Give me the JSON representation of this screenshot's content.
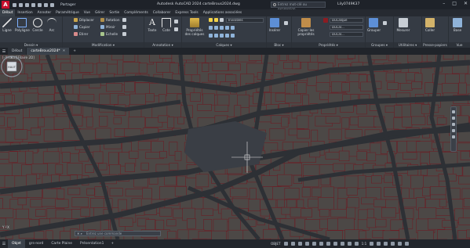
{
  "titlebar": {
    "app_logo": "A",
    "share_label": "Partager",
    "window_title": "Autodesk AutoCAD 2024    carteBrous2024.dwg",
    "search_placeholder": "Entrez mot-clé ou expression",
    "user": "Lily0749K37"
  },
  "ribbon_tabs": [
    "Début",
    "Insertion",
    "Annoter",
    "Paramétrique",
    "Vue",
    "Gérer",
    "Sortie",
    "Compléments",
    "Collaborer",
    "Express Tools",
    "Applications associées"
  ],
  "ribbon": {
    "dessin": {
      "title": "Dessin ▾",
      "ligne": "Ligne",
      "polyligne": "Polyligne",
      "cercle": "Cercle",
      "arc": "Arc"
    },
    "modification": {
      "title": "Modification ▾",
      "deplacer": "Déplacer",
      "rotation": "Rotation",
      "copier": "Copier",
      "miroir": "Miroir",
      "etirer": "Etirer",
      "echelle": "Echelle"
    },
    "annotation": {
      "title": "Annotation ▾",
      "texte": "Texte",
      "cote": "Cote"
    },
    "calques": {
      "title": "Calques ▾",
      "proprietes": "Propriétés des calques",
      "layer_combo": "Invisibles"
    },
    "bloc": {
      "title": "Bloc ▾",
      "inserer": "Insérer"
    },
    "proprietes": {
      "title": "Propriétés ▾",
      "copier_props": "Copier les propriétés",
      "c1": "DuCalque",
      "c2": "DuCal...",
      "c3": "DuCal..."
    },
    "groupes": {
      "title": "Groupes ▾",
      "grouper": "Grouper"
    },
    "utilitaires": {
      "title": "Utilitaires ▾",
      "mesurer": "Mesurer"
    },
    "presse": {
      "title": "Presse-papiers",
      "coller": "Coller"
    },
    "vue": {
      "title": "Vue",
      "base": "Base"
    }
  },
  "file_tabs": [
    {
      "label": "Début"
    },
    {
      "label": "carteBrous2024*"
    }
  ],
  "drawing": {
    "view_label": "[-][Haut][Filaire 2D]",
    "viewcube_label": "HAUT",
    "command_placeholder": "Entrez une commande",
    "command_prefix": "✕ ⌕"
  },
  "layout_tabs": [
    "Objet",
    "grs-nord",
    "Carte Plaine",
    "Présentation1"
  ],
  "status": {
    "model_label": "OBJET",
    "scale": "1:1"
  },
  "colors": {
    "background_drawing": "#4c4846",
    "building_outline": "#6a1f26",
    "road": "#2d3035",
    "accent": "#3a4149"
  }
}
